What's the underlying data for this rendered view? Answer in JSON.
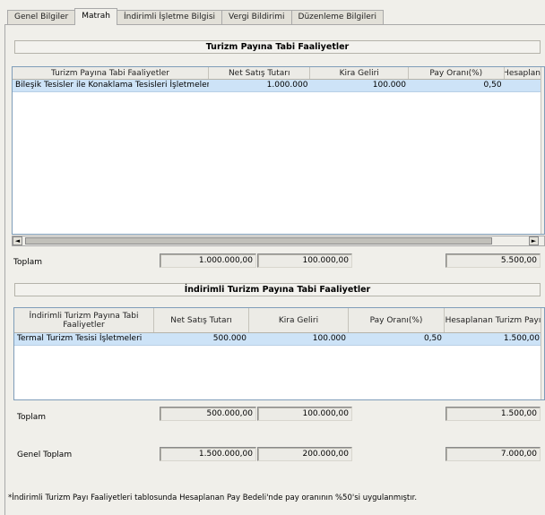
{
  "tabs": [
    {
      "label": "Genel Bilgiler",
      "active": false
    },
    {
      "label": "Matrah",
      "active": true
    },
    {
      "label": "İndirimli İşletme Bilgisi",
      "active": false
    },
    {
      "label": "Vergi Bildirimi",
      "active": false
    },
    {
      "label": "Düzenleme Bilgileri",
      "active": false
    }
  ],
  "section1": {
    "title": "Turizm Payına Tabi Faaliyetler",
    "columns": [
      "Turizm Payına Tabi Faaliyetler",
      "Net Satış Tutarı",
      "Kira Geliri",
      "Pay Oranı(%)",
      "Hesaplana"
    ],
    "rows": [
      [
        "Bileşik Tesisler ile Konaklama Tesisleri İşletmeleri",
        "1.000.000",
        "100.000",
        "0,50",
        ""
      ]
    ],
    "total_label": "Toplam",
    "totals": {
      "net": "1.000.000,00",
      "kira": "100.000,00",
      "hesaplanan": "5.500,00"
    }
  },
  "section2": {
    "title": "İndirimli Turizm Payına Tabi Faaliyetler",
    "columns": [
      "İndirimli Turizm Payına Tabi Faaliyetler",
      "Net Satış Tutarı",
      "Kira Geliri",
      "Pay Oranı(%)",
      "Hesaplanan Turizm Payı"
    ],
    "rows": [
      [
        "Termal Turizm Tesisi İşletmeleri",
        "500.000",
        "100.000",
        "0,50",
        "1.500,00"
      ]
    ],
    "total_label": "Toplam",
    "totals": {
      "net": "500.000,00",
      "kira": "100.000,00",
      "hesaplanan": "1.500,00"
    }
  },
  "grand_total": {
    "label": "Genel Toplam",
    "net": "1.500.000,00",
    "kira": "200.000,00",
    "hesaplanan": "7.000,00"
  },
  "footnote": "*İndirimli Turizm Payı Faaliyetleri tablosunda Hesaplanan Pay Bedeli'nde pay oranının %50'si uygulanmıştır.",
  "icons": {
    "scroll_left": "◄",
    "scroll_right": "►"
  }
}
